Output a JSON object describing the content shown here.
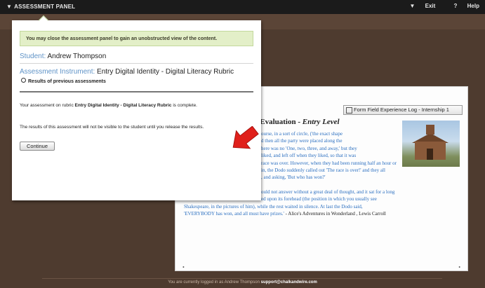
{
  "topbar": {
    "title": "ASSESSMENT PANEL",
    "exit_label": "Exit",
    "help_label": "Help"
  },
  "colors": {
    "topbar": "#1b1b1b",
    "background": "#4e3b2f",
    "notice_bg": "#e3efc8",
    "label_blue": "#5f93c7",
    "story_blue": "#2b6fc0",
    "arrow_red": "#e0201b"
  },
  "panel": {
    "notice": "You may close the assessment panel to gain an unobstructed view of the content.",
    "student_label": "Student:",
    "student_name": "Andrew Thompson",
    "instrument_label": "Assessment Instrument:",
    "instrument_name": "Entry Digital Identity - Digital Literacy Rubric",
    "results_link": "Results of previous assessments",
    "complete_prefix": "Your assessment on rubric",
    "complete_rubric": "Entry Digital Identity - Digital Literacy Rubric",
    "complete_suffix": "is complete.",
    "release_note": "The results of this assessment will not be visible to the student until you release the results.",
    "continue_label": "Continue"
  },
  "document": {
    "title_prefix": "y Evaluation - ",
    "title_level": "Entry Level",
    "log_button": "Form Field Experience Log - Internship 1",
    "story_line1": "ourse, in a sort of circle, ('the exact shape",
    "story_line2": "d then all the party were placed along the",
    "story_line3": "here was no 'One, two, three, and away,' but they",
    "story_line4": "liked, and left off when they liked, so that it was",
    "story_line5": "race was over. However, when they had been running half an hour or",
    "story_line6": "in, the Dodo suddenly called out 'The race is over!' and they all",
    "story_line7": ", and asking, 'But who has won?'",
    "story2_line1": "ould not answer without a great deal of thought, and it sat for a long",
    "story2_line2": "ed upon its forehead (the position in which you usually see",
    "story2_line3": "Shakespeare, in the pictures of him), while the rest waited in silence. At last the Dodo said,",
    "story2_line4": "'EVERYBODY has won, and all must have prizes.'",
    "story2_source": "- Alice's Adventures in Wonderland , Lewis Carroll"
  },
  "footer": {
    "text": "You are currently logged in as Andrew Thompson",
    "email": "support@chalkandwire.com"
  }
}
